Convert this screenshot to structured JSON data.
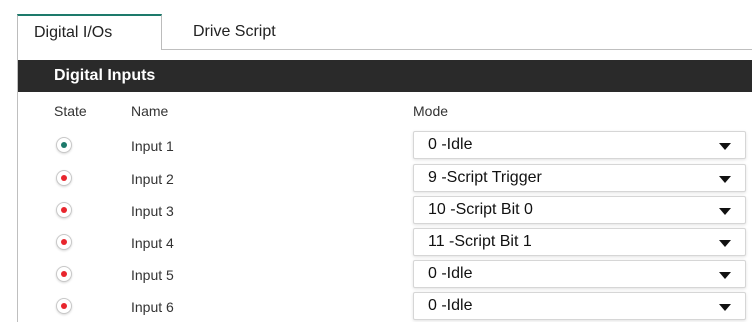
{
  "tabs": [
    {
      "label": "Digital I/Os",
      "active": true
    },
    {
      "label": "Drive Script",
      "active": false
    }
  ],
  "section": {
    "title": "Digital Inputs"
  },
  "columns": {
    "state": "State",
    "name": "Name",
    "mode": "Mode"
  },
  "colors": {
    "state_on": "#1d7a6b",
    "state_off": "#e8262e",
    "header_bg": "#2a2a2a",
    "tab_accent": "#1d7a6b"
  },
  "inputs": [
    {
      "name": "Input 1",
      "state": "on",
      "mode": "0  -Idle"
    },
    {
      "name": "Input 2",
      "state": "off",
      "mode": "9  -Script Trigger"
    },
    {
      "name": "Input 3",
      "state": "off",
      "mode": "10  -Script Bit 0"
    },
    {
      "name": "Input 4",
      "state": "off",
      "mode": "11  -Script Bit 1"
    },
    {
      "name": "Input 5",
      "state": "off",
      "mode": "0  -Idle"
    },
    {
      "name": "Input 6",
      "state": "off",
      "mode": "0  -Idle"
    }
  ]
}
